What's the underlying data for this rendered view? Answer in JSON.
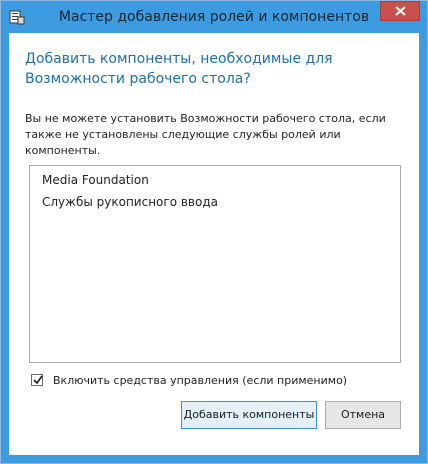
{
  "window": {
    "title": "Мастер добавления ролей и компонентов",
    "colors": {
      "frame": "#3d9be0",
      "close": "#c7504c",
      "heading": "#1e6fa8"
    }
  },
  "dialog": {
    "heading": "Добавить компоненты, необходимые для Возможности рабочего стола?",
    "message": "Вы не можете установить Возможности рабочего стола, если также не установлены следующие службы ролей или компоненты.",
    "features": [
      "Media Foundation",
      "Службы рукописного ввода"
    ],
    "include_management_tools": {
      "label": "Включить средства управления (если применимо)",
      "checked": true
    },
    "buttons": {
      "add": "Добавить компоненты",
      "cancel": "Отмена"
    }
  }
}
